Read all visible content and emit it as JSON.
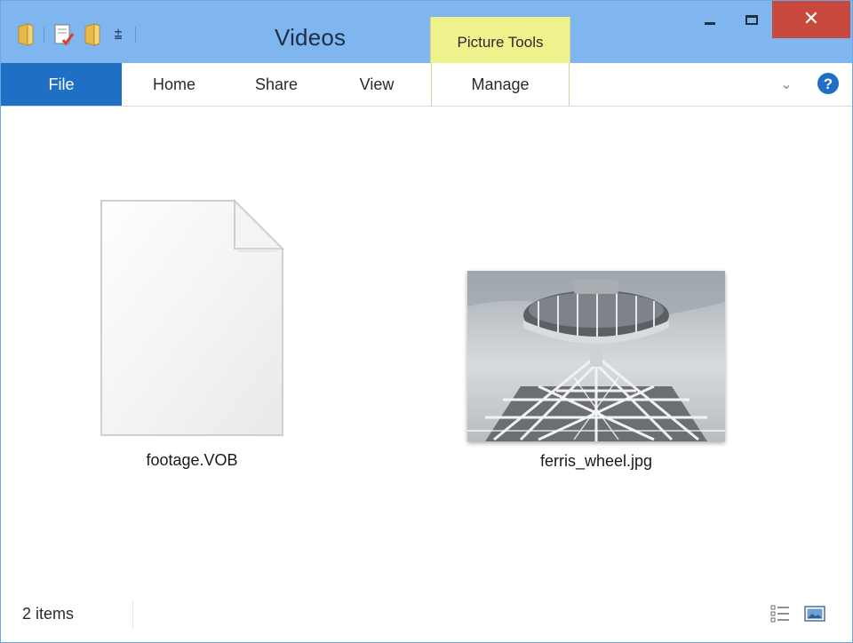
{
  "window": {
    "title": "Videos",
    "context_tab": "Picture Tools",
    "qat_dropdown": "⩲",
    "close_glyph": "✕"
  },
  "ribbon": {
    "tabs": {
      "file": "File",
      "home": "Home",
      "share": "Share",
      "view": "View",
      "manage": "Manage"
    },
    "expand_glyph": "⌄",
    "help_glyph": "?"
  },
  "files": [
    {
      "name": "footage.VOB",
      "icon": "generic-document-icon"
    },
    {
      "name": "ferris_wheel.jpg",
      "icon": "image-thumbnail"
    }
  ],
  "status": {
    "item_count": "2 items"
  },
  "colors": {
    "titlebar": "#7fb6f0",
    "file_tab": "#1f6fc5",
    "context_tab": "#eef18c",
    "close_button": "#c9483e",
    "help": "#1f6fc5"
  }
}
